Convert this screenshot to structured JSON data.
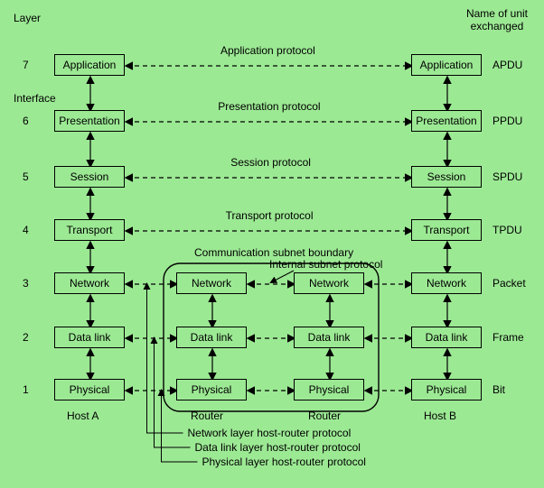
{
  "headers": {
    "layer": "Layer",
    "unit": "Name of unit\nexchanged",
    "interface": "Interface"
  },
  "layers": [
    {
      "num": "7",
      "name": "Application",
      "proto": "Application protocol",
      "unit": "APDU"
    },
    {
      "num": "6",
      "name": "Presentation",
      "proto": "Presentation protocol",
      "unit": "PPDU"
    },
    {
      "num": "5",
      "name": "Session",
      "proto": "Session protocol",
      "unit": "SPDU"
    },
    {
      "num": "4",
      "name": "Transport",
      "proto": "Transport protocol",
      "unit": "TPDU"
    },
    {
      "num": "3",
      "name": "Network",
      "proto": "",
      "unit": "Packet"
    },
    {
      "num": "2",
      "name": "Data link",
      "proto": "",
      "unit": "Frame"
    },
    {
      "num": "1",
      "name": "Physical",
      "proto": "",
      "unit": "Bit"
    }
  ],
  "router_layers": [
    "Network",
    "Data link",
    "Physical"
  ],
  "footer": {
    "hostA": "Host A",
    "hostB": "Host B",
    "router": "Router",
    "subnet": "Communication subnet boundary",
    "internal": "Internal subnet protocol",
    "net_hr": "Network layer host-router protocol",
    "dl_hr": "Data link layer host-router protocol",
    "phy_hr": "Physical layer host-router protocol"
  }
}
